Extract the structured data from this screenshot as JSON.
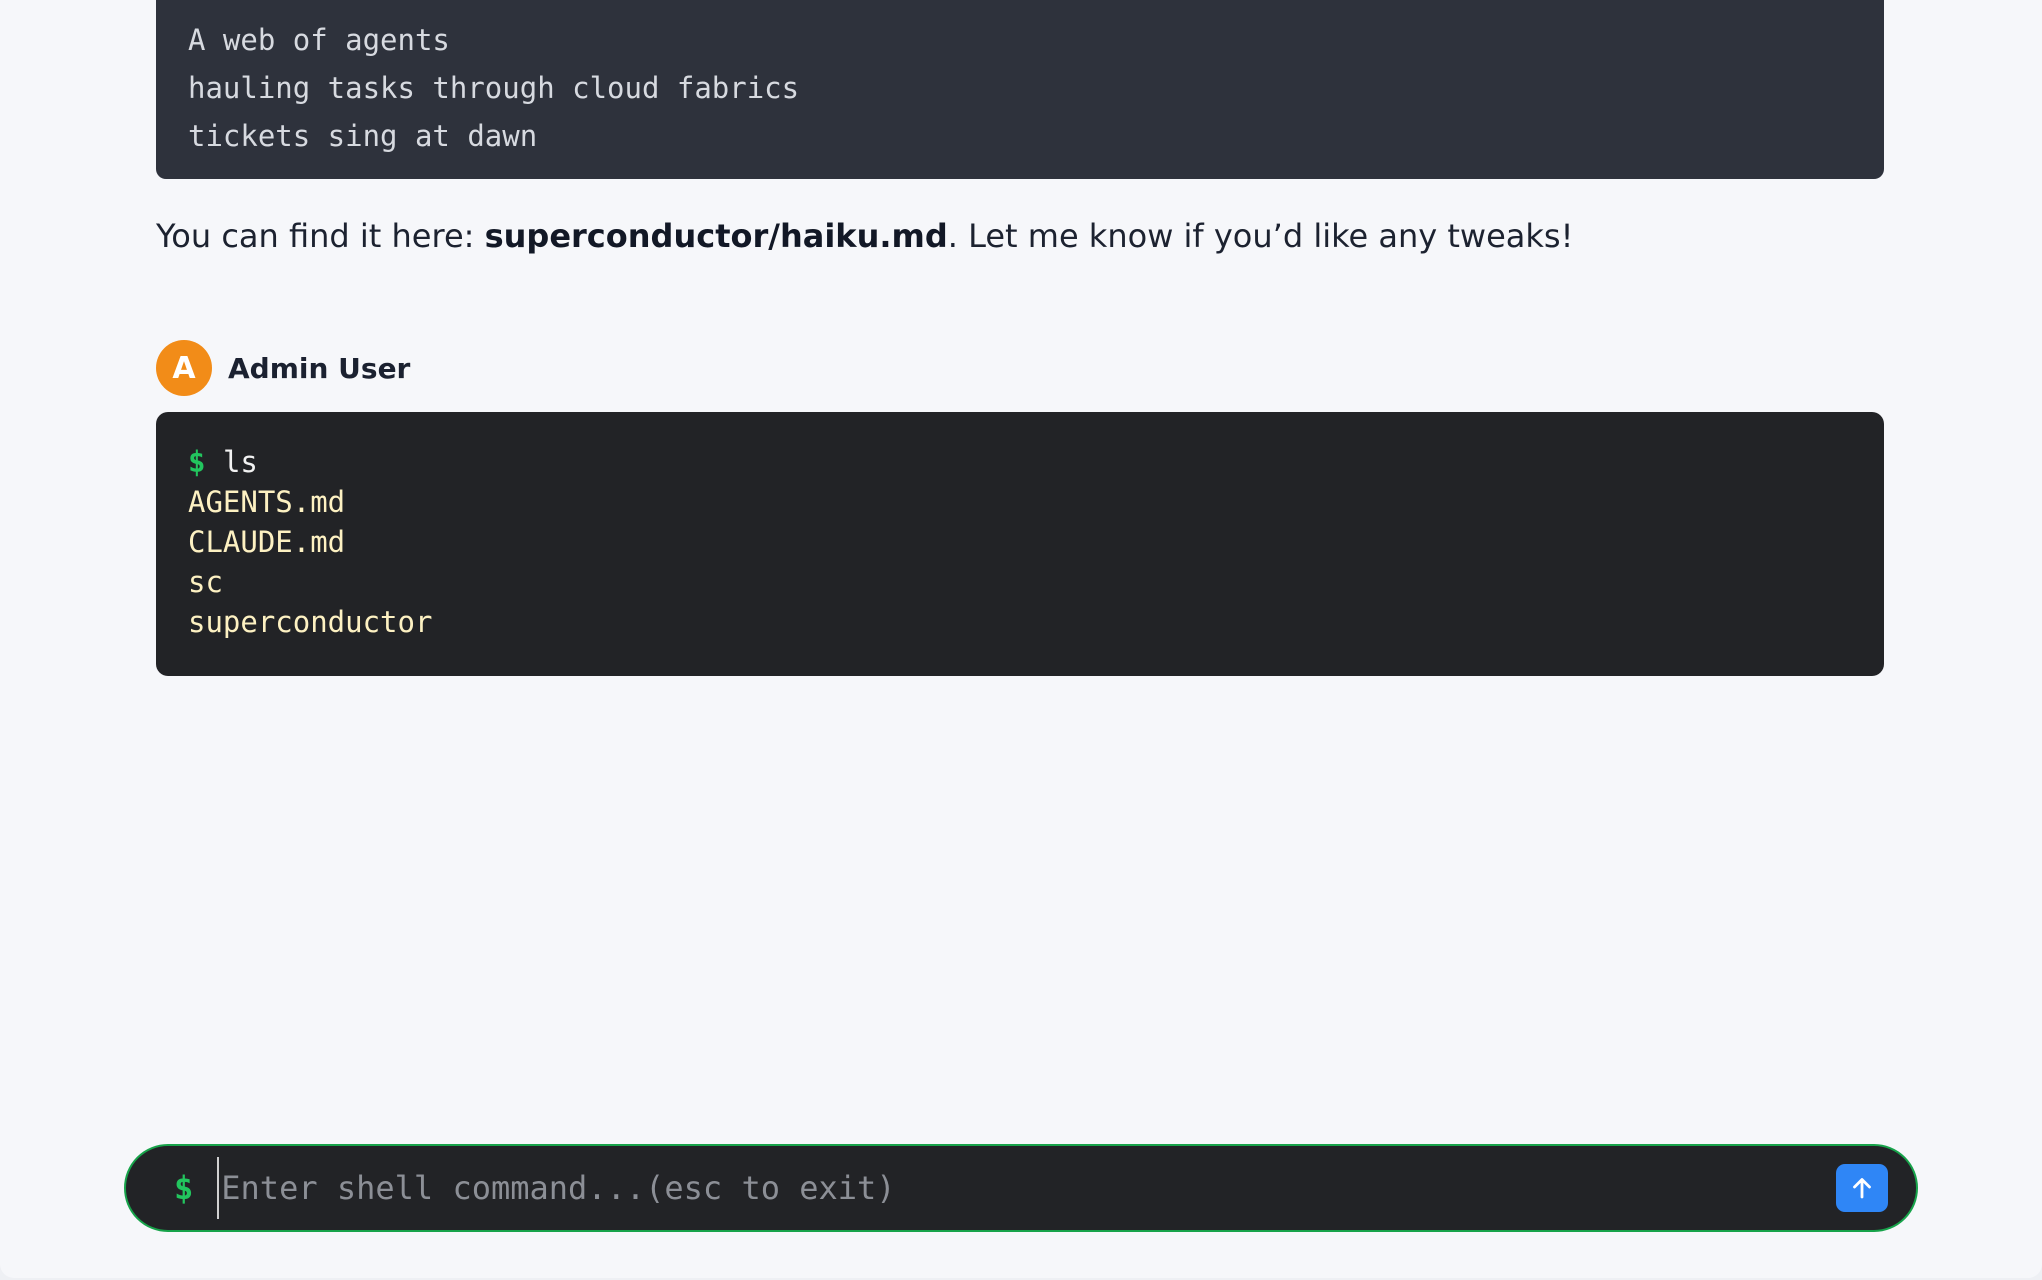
{
  "haiku": {
    "lines": [
      "A web of agents",
      "hauling tasks through cloud fabrics",
      "tickets sing at dawn"
    ]
  },
  "reply": {
    "prefix": "You can find it here: ",
    "file_path": "superconductor/haiku.md",
    "suffix": ". Let me know if you’d like any tweaks!"
  },
  "author": {
    "avatar_letter": "A",
    "name": "Admin User",
    "avatar_color": "#f28c18"
  },
  "terminal": {
    "prompt": "$",
    "command": "ls",
    "output": [
      "AGENTS.md",
      "CLAUDE.md",
      "sc",
      "superconductor"
    ]
  },
  "shell_input": {
    "prompt": "$",
    "value": "",
    "placeholder": "Enter shell command...(esc to exit)",
    "send_icon": "arrow-up-icon",
    "border_color": "#17a34a",
    "send_color": "#2f86f6"
  }
}
